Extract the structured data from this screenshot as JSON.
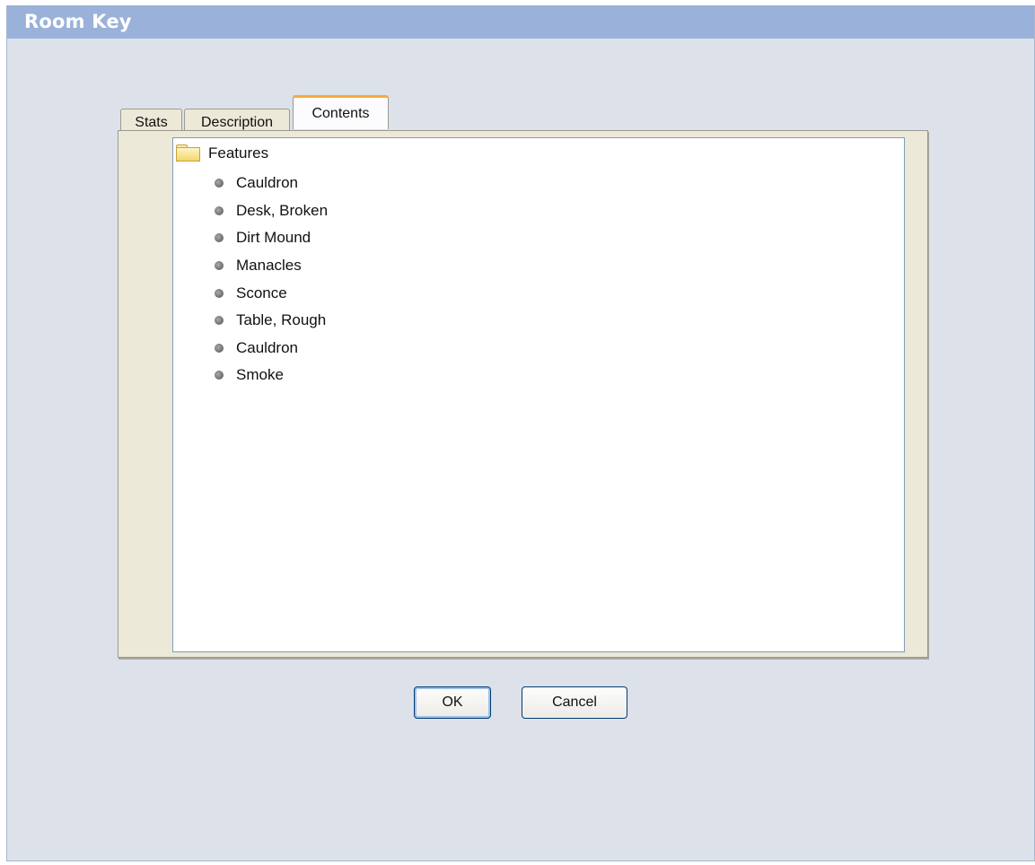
{
  "window": {
    "title": "Room Key"
  },
  "tabs": [
    {
      "label": "Stats",
      "active": false
    },
    {
      "label": "Description",
      "active": false
    },
    {
      "label": "Contents",
      "active": true
    }
  ],
  "tree": {
    "folder": {
      "label": "Features",
      "icon": "folder-icon"
    },
    "items": [
      {
        "label": "Cauldron",
        "icon": "bullet-icon"
      },
      {
        "label": "Desk, Broken",
        "icon": "bullet-icon"
      },
      {
        "label": "Dirt Mound",
        "icon": "bullet-icon"
      },
      {
        "label": "Manacles",
        "icon": "bullet-icon"
      },
      {
        "label": "Sconce",
        "icon": "bullet-icon"
      },
      {
        "label": "Table, Rough",
        "icon": "bullet-icon"
      },
      {
        "label": "Cauldron",
        "icon": "bullet-icon"
      },
      {
        "label": "Smoke",
        "icon": "bullet-icon"
      }
    ]
  },
  "buttons": {
    "ok_label": "OK",
    "cancel_label": "Cancel"
  },
  "colors": {
    "titlebar": "#9ab2d9",
    "window_bg": "#dde1ea",
    "active_tab_accent": "#f7a93b",
    "button_border": "#003c74"
  }
}
